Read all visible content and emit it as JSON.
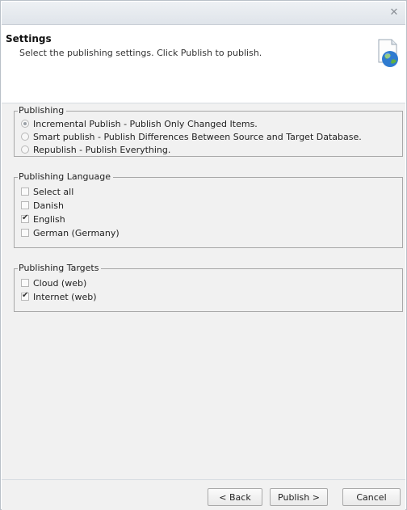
{
  "window": {
    "close_symbol": "✕"
  },
  "header": {
    "title": "Settings",
    "subtitle": "Select the publishing settings. Click Publish to publish.",
    "icon": "globe-document-icon"
  },
  "publishing": {
    "legend": "Publishing",
    "options": [
      {
        "label": "Incremental Publish - Publish Only Changed Items.",
        "selected": true
      },
      {
        "label": "Smart publish - Publish Differences Between Source and Target Database.",
        "selected": false
      },
      {
        "label": "Republish - Publish Everything.",
        "selected": false
      }
    ]
  },
  "language": {
    "legend": "Publishing Language",
    "items": [
      {
        "label": "Select all",
        "checked": false
      },
      {
        "label": "Danish",
        "checked": false
      },
      {
        "label": "English",
        "checked": true
      },
      {
        "label": "German (Germany)",
        "checked": false
      }
    ]
  },
  "targets": {
    "legend": "Publishing Targets",
    "items": [
      {
        "label": "Cloud (web)",
        "checked": false
      },
      {
        "label": "Internet (web)",
        "checked": true
      }
    ]
  },
  "footer": {
    "back_label": "< Back",
    "publish_label": "Publish >",
    "cancel_label": "Cancel"
  }
}
